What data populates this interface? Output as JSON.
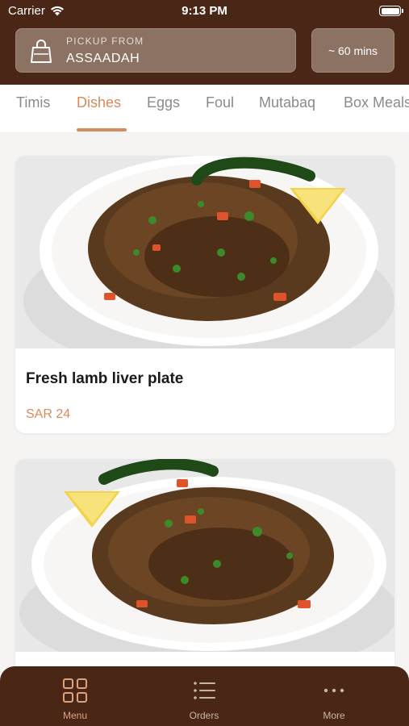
{
  "status_bar": {
    "carrier": "Carrier",
    "time": "9:13 PM"
  },
  "header": {
    "pickup_label": "PICKUP FROM",
    "pickup_location": "ASSAADAH",
    "time_estimate": "~ 60 mins"
  },
  "tabs": [
    {
      "label": "Timis",
      "active": false
    },
    {
      "label": "Dishes",
      "active": true
    },
    {
      "label": "Eggs",
      "active": false
    },
    {
      "label": "Foul",
      "active": false
    },
    {
      "label": "Mutabaq",
      "active": false
    },
    {
      "label": "Box Meals",
      "active": false
    }
  ],
  "menu_items": [
    {
      "title": "Fresh lamb liver plate",
      "price": "SAR 24"
    },
    {
      "title": "",
      "price": ""
    }
  ],
  "bottom_nav": [
    {
      "label": "Menu",
      "icon": "grid-icon",
      "active": true
    },
    {
      "label": "Orders",
      "icon": "list-icon",
      "active": false
    },
    {
      "label": "More",
      "icon": "more-icon",
      "active": false
    }
  ],
  "colors": {
    "brand_brown": "#4a2616",
    "accent": "#d88a5c",
    "pickup_box": "#8c7262"
  }
}
